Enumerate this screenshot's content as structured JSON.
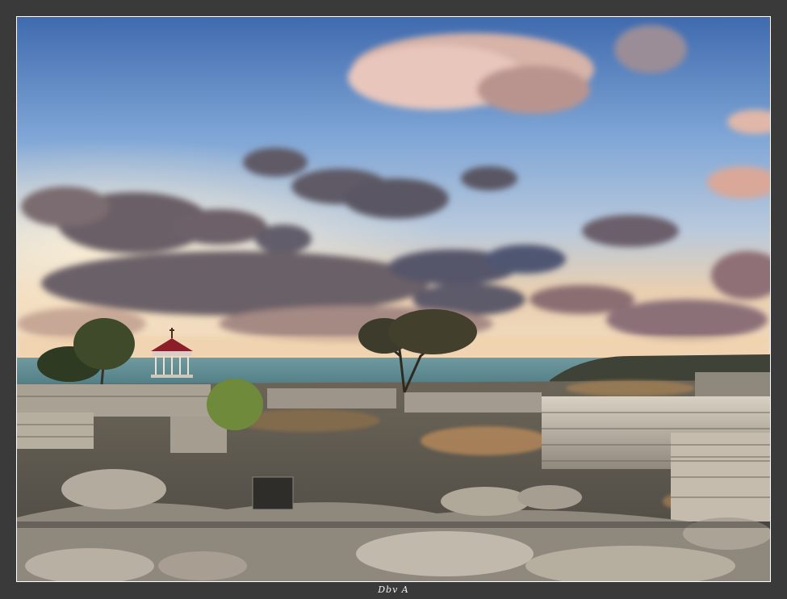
{
  "photo": {
    "subject": "coastal-ruins-at-sunset",
    "colors": {
      "frame_background": "#3a3a3a",
      "frame_border": "#ffffff",
      "sky_top": "#4f79b8",
      "sky_mid": "#9fbfe0",
      "horizon_glow": "#f0d0a8",
      "cloud_dark": "#5e5a66",
      "cloud_light": "#e8c6bc",
      "sea": "#4f7e86",
      "stone": "#b9b2a6",
      "ground_shadow": "#3d3a37",
      "gazebo_roof": "#8a1f2a"
    }
  },
  "signature": {
    "text": "Dbv A"
  }
}
